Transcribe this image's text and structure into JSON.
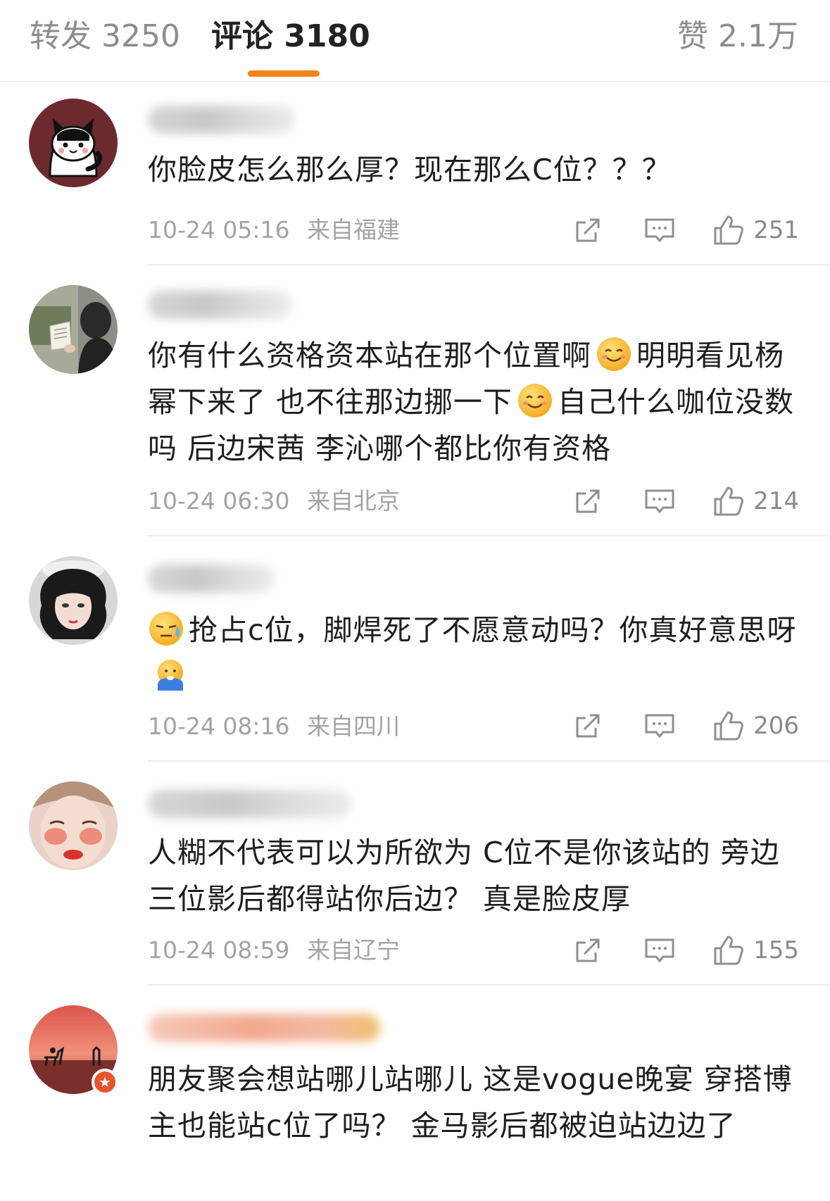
{
  "tabs": {
    "repost": "转发 3250",
    "comment": "评论 3180",
    "like": "赞 2.1万"
  },
  "colors": {
    "accent": "#f5821f",
    "meta": "#a3a3a3",
    "text": "#1e1e1e"
  },
  "comments": [
    {
      "text": "你脸皮怎么那么厚？现在那么C位？？？",
      "time": "10-24 05:16",
      "location": "来自福建",
      "likes": "251",
      "avatar_icon": "cat-avatar-icon"
    },
    {
      "text_parts": [
        "你有什么资格资本站在那个位置啊",
        "明明看见杨幂下来了 也不往那边挪一下",
        "自己什么咖位没数吗 后边宋茜 李沁哪个都比你有资格"
      ],
      "time": "10-24 06:30",
      "location": "来自北京",
      "likes": "214",
      "avatar_icon": "reading-girl-avatar-icon",
      "emoji_icons": [
        "smile-emoji-icon",
        "smile-emoji-icon"
      ]
    },
    {
      "text_parts": [
        "抢占c位，脚焊死了不愿意动吗？你真好意思呀"
      ],
      "time": "10-24 08:16",
      "location": "来自四川",
      "likes": "206",
      "avatar_icon": "curly-hair-girl-avatar-icon",
      "emoji_icons": [
        "sweat-emoji-icon",
        "cold-emoji-icon"
      ]
    },
    {
      "text": "人糊不代表可以为所欲为 C位不是你该站的 旁边三位影后都得站你后边？  真是脸皮厚",
      "time": "10-24 08:59",
      "location": "来自辽宁",
      "likes": "155",
      "avatar_icon": "blush-face-avatar-icon"
    },
    {
      "text": "朋友聚会想站哪儿站哪儿 这是vogue晚宴  穿搭博主也能站c位了吗？  金马影后都被迫站边边了",
      "avatar_icon": "sunset-horse-avatar-icon",
      "badge_icon": "vip-star-badge-icon"
    }
  ]
}
